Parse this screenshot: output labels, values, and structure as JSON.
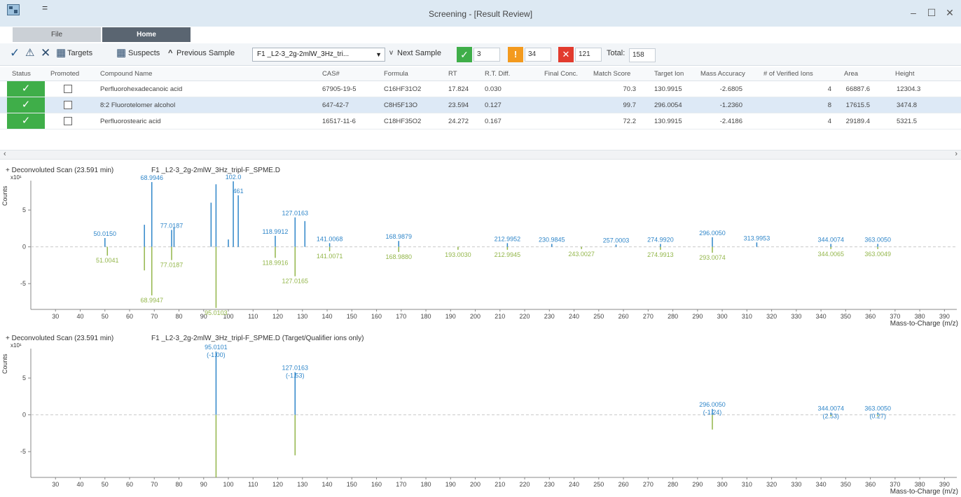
{
  "window": {
    "title": "Screening - [Result Review]",
    "quick_access": "="
  },
  "ribbon": {
    "tabs": [
      {
        "label": "File"
      },
      {
        "label": "Home"
      }
    ]
  },
  "toolbar": {
    "targets_label": "Targets",
    "suspects_label": "Suspects",
    "previous_sample_label": "Previous Sample",
    "sample_value": "F1 _L2-3_2g-2mlW_3Hz_tri...",
    "next_sample_label": "Next Sample",
    "count_ok": "3",
    "count_warn": "34",
    "count_fail": "121",
    "total_label": "Total:",
    "total_value": "158",
    "colors": {
      "ok": "#3fae49",
      "warn": "#f39a1e",
      "fail": "#e23b2e"
    }
  },
  "table": {
    "headers": [
      "Status",
      "Promoted",
      "Compound Name",
      "CAS#",
      "Formula",
      "RT",
      "R.T. Diff.",
      "Final Conc.",
      "Match Score",
      "Target Ion",
      "Mass Accuracy",
      "# of Verified Ions",
      "Area",
      "Height"
    ],
    "rows": [
      {
        "status": "✓",
        "name": "Perfluorohexadecanoic acid",
        "cas": "67905-19-5",
        "formula": "C16HF31O2",
        "rt": "17.824",
        "rt_diff": "0.030",
        "final_conc": "",
        "match_score": "70.3",
        "target_ion": "130.9915",
        "mass_accuracy": "-2.6805",
        "verified_ions": "4",
        "area": "66887.6",
        "height": "12304.3"
      },
      {
        "status": "✓",
        "name": "8:2 Fluorotelomer alcohol",
        "cas": "647-42-7",
        "formula": "C8H5F13O",
        "rt": "23.594",
        "rt_diff": "0.127",
        "final_conc": "",
        "match_score": "99.7",
        "target_ion": "296.0054",
        "mass_accuracy": "-1.2360",
        "verified_ions": "8",
        "area": "17615.5",
        "height": "3474.8"
      },
      {
        "status": "✓",
        "name": "Perfluorostearic acid",
        "cas": "16517-11-6",
        "formula": "C18HF35O2",
        "rt": "24.272",
        "rt_diff": "0.167",
        "final_conc": "",
        "match_score": "72.2",
        "target_ion": "130.9915",
        "mass_accuracy": "-2.4186",
        "verified_ions": "4",
        "area": "29189.4",
        "height": "5321.5"
      }
    ]
  },
  "plot1": {
    "title": "+ Deconvoluted Scan (23.591 min)",
    "file": "F1 _L2-3_2g-2mlW_3Hz_tripl-F_SPME.D",
    "ylabel": "Counts",
    "multiplier": "x10¹",
    "xlabel": "Mass-to-Charge (m/z)"
  },
  "plot2": {
    "title": "+ Deconvoluted Scan (23.591 min)",
    "file": "F1 _L2-3_2g-2mlW_3Hz_tripl-F_SPME.D (Target/Qualifier ions only)",
    "ylabel": "Counts",
    "multiplier": "x10¹",
    "xlabel": "Mass-to-Charge (m/z)"
  },
  "chart_data": [
    {
      "type": "bar",
      "title": "+ Deconvoluted Scan (23.591 min)",
      "xlabel": "Mass-to-Charge (m/z)",
      "ylabel": "Counts",
      "xlim": [
        20,
        395
      ],
      "ylim": [
        -8.5,
        9
      ],
      "xticks": [
        30,
        40,
        50,
        60,
        70,
        80,
        90,
        100,
        110,
        120,
        130,
        140,
        150,
        160,
        170,
        180,
        190,
        200,
        210,
        220,
        230,
        240,
        250,
        260,
        270,
        280,
        290,
        300,
        310,
        320,
        330,
        340,
        350,
        360,
        370,
        380,
        390
      ],
      "yticks": [
        5,
        0,
        -5
      ],
      "series": [
        {
          "color": "#2f86c9",
          "points": [
            {
              "x": 50.015,
              "y": 1.2,
              "label": "50.0150"
            },
            {
              "x": 66.0,
              "y": 3.0,
              "label": ""
            },
            {
              "x": 68.9946,
              "y": 8.8,
              "label": "68.9946"
            },
            {
              "x": 77.0187,
              "y": 2.3,
              "label": "77.0187"
            },
            {
              "x": 78.0,
              "y": 2.6,
              "label": ""
            },
            {
              "x": 93.0,
              "y": 6.0,
              "label": ""
            },
            {
              "x": 95.0,
              "y": 8.5,
              "label": ""
            },
            {
              "x": 100.0,
              "y": 1.0,
              "label": ""
            },
            {
              "x": 102.0,
              "y": 8.9,
              "label": "102.0"
            },
            {
              "x": 104.0,
              "y": 7.0,
              "label": "461"
            },
            {
              "x": 118.9912,
              "y": 1.5,
              "label": "118.9912"
            },
            {
              "x": 127.0163,
              "y": 4.0,
              "label": "127.0163"
            },
            {
              "x": 130.9915,
              "y": 3.5,
              "label": ""
            },
            {
              "x": 141.0068,
              "y": 0.5,
              "label": "141.0068"
            },
            {
              "x": 168.9879,
              "y": 0.8,
              "label": "168.9879"
            },
            {
              "x": 212.9952,
              "y": 0.5,
              "label": "212.9952"
            },
            {
              "x": 230.9845,
              "y": 0.4,
              "label": "230.9845"
            },
            {
              "x": 257.0003,
              "y": 0.3,
              "label": "257.0003"
            },
            {
              "x": 274.992,
              "y": 0.4,
              "label": "274.9920"
            },
            {
              "x": 296.005,
              "y": 1.3,
              "label": "296.0050"
            },
            {
              "x": 313.9953,
              "y": 0.6,
              "label": "313.9953"
            },
            {
              "x": 344.0074,
              "y": 0.4,
              "label": "344.0074"
            },
            {
              "x": 363.005,
              "y": 0.4,
              "label": "363.0050"
            }
          ]
        },
        {
          "color": "#93b64a",
          "points": [
            {
              "x": 51.0041,
              "y": -1.2,
              "label": "51.0041"
            },
            {
              "x": 66.0,
              "y": -3.2,
              "label": ""
            },
            {
              "x": 68.9947,
              "y": -6.6,
              "label": "68.9947"
            },
            {
              "x": 77.0187,
              "y": -1.8,
              "label": "77.0187"
            },
            {
              "x": 95.0103,
              "y": -8.3,
              "label": "95.0103"
            },
            {
              "x": 118.9916,
              "y": -1.5,
              "label": "118.9916"
            },
            {
              "x": 127.0165,
              "y": -4.0,
              "label": "127.0165"
            },
            {
              "x": 141.0071,
              "y": -0.6,
              "label": "141.0071"
            },
            {
              "x": 168.988,
              "y": -0.7,
              "label": "168.9880"
            },
            {
              "x": 193.003,
              "y": -0.4,
              "label": "193.0030"
            },
            {
              "x": 212.9945,
              "y": -0.4,
              "label": "212.9945"
            },
            {
              "x": 243.0027,
              "y": -0.3,
              "label": "243.0027"
            },
            {
              "x": 274.9913,
              "y": -0.4,
              "label": "274.9913"
            },
            {
              "x": 296.0074,
              "y": -0.8,
              "label": "293.0074"
            },
            {
              "x": 344.0065,
              "y": -0.3,
              "label": "344.0065"
            },
            {
              "x": 363.0049,
              "y": -0.3,
              "label": "363.0049"
            }
          ]
        }
      ]
    },
    {
      "type": "bar",
      "title": "+ Deconvoluted Scan (23.591 min)",
      "xlabel": "Mass-to-Charge (m/z)",
      "ylabel": "Counts",
      "xlim": [
        20,
        395
      ],
      "ylim": [
        -8.5,
        9
      ],
      "xticks": [
        30,
        40,
        50,
        60,
        70,
        80,
        90,
        100,
        110,
        120,
        130,
        140,
        150,
        160,
        170,
        180,
        190,
        200,
        210,
        220,
        230,
        240,
        250,
        260,
        270,
        280,
        290,
        300,
        310,
        320,
        330,
        340,
        350,
        360,
        370,
        380,
        390
      ],
      "yticks": [
        5,
        0,
        -5
      ],
      "series": [
        {
          "color": "#2f86c9",
          "points": [
            {
              "x": 95.0101,
              "y": 8.6,
              "label": "95.0101",
              "sublabel": "(-1.00)"
            },
            {
              "x": 127.0163,
              "y": 5.8,
              "label": "127.0163",
              "sublabel": "(-1.53)"
            },
            {
              "x": 296.005,
              "y": 0.8,
              "label": "296.0050",
              "sublabel": "(-1.24)"
            },
            {
              "x": 344.0074,
              "y": 0.3,
              "label": "344.0074",
              "sublabel": "(2.53)"
            },
            {
              "x": 363.005,
              "y": 0.3,
              "label": "363.0050",
              "sublabel": "(0.27)"
            }
          ]
        },
        {
          "color": "#93b64a",
          "points": [
            {
              "x": 95.0101,
              "y": -8.5
            },
            {
              "x": 127.0163,
              "y": -5.5
            },
            {
              "x": 296.005,
              "y": -2.0
            },
            {
              "x": 344.0074,
              "y": -0.2
            },
            {
              "x": 363.005,
              "y": -0.2
            }
          ]
        }
      ]
    }
  ]
}
